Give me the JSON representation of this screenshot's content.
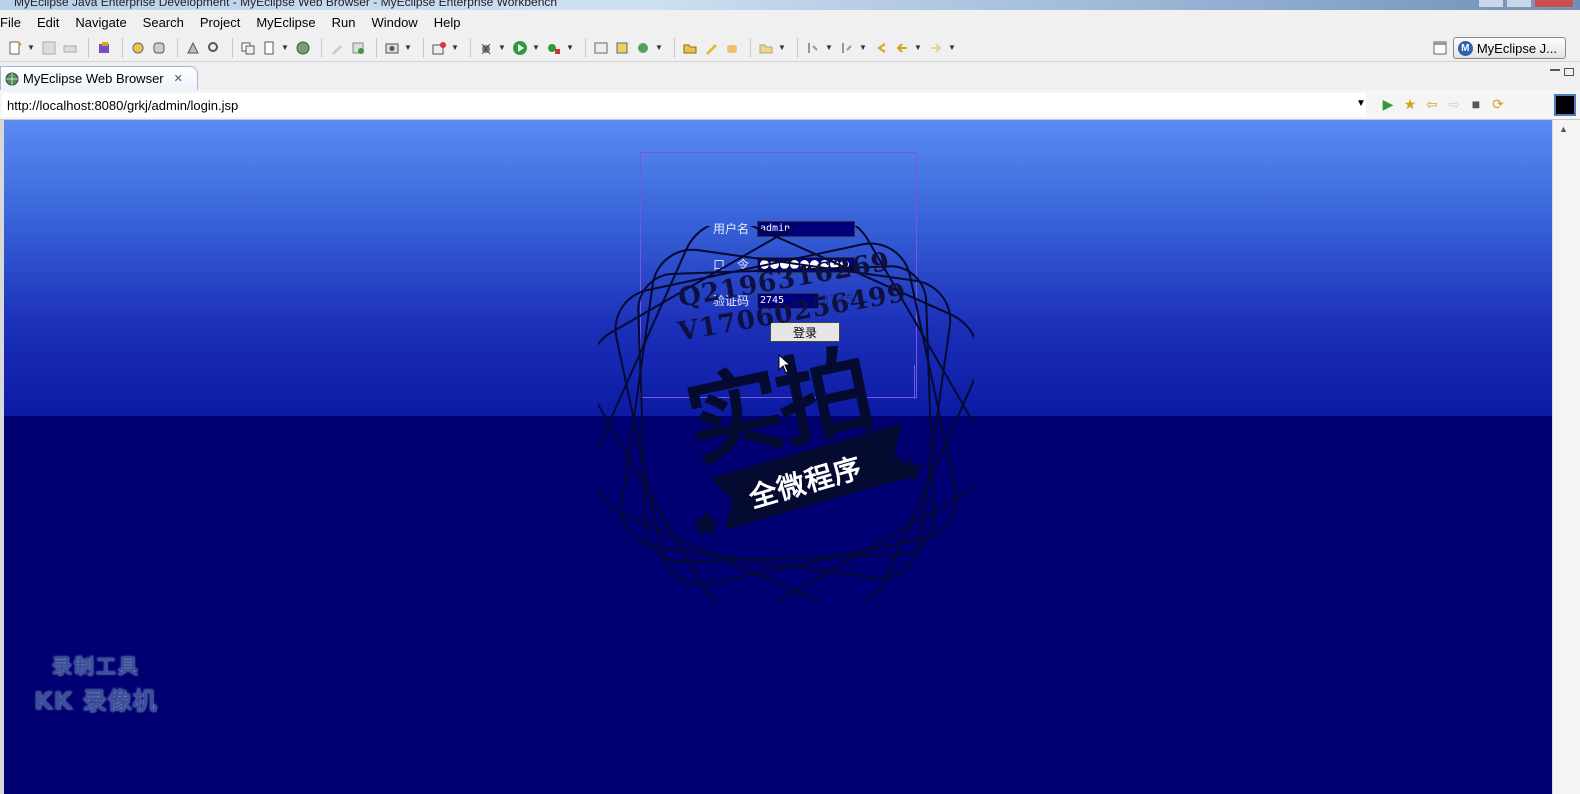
{
  "window": {
    "title": "MyEclipse Java Enterprise Development - MyEclipse Web Browser - MyEclipse Enterprise Workbench"
  },
  "menu": [
    "File",
    "Edit",
    "Navigate",
    "Search",
    "Project",
    "MyEclipse",
    "Run",
    "Window",
    "Help"
  ],
  "perspective": {
    "label": "MyEclipse J..."
  },
  "editor_tab": {
    "label": "MyEclipse Web Browser"
  },
  "address": {
    "url": "http://localhost:8080/grkj/admin/login.jsp"
  },
  "login": {
    "username_label": "用户名",
    "username_value": "admin",
    "password_label": "口　令",
    "captcha_label": "验证码",
    "captcha_input": "2745",
    "captcha_image": "2745",
    "submit_label": "登录"
  },
  "stamp": {
    "line1": "Q2196316269",
    "line2": "V17060256499",
    "big": "实拍",
    "banner": "全微程序"
  },
  "watermark": {
    "line1": "录制工具",
    "line2": "KK 录像机"
  },
  "colors": {
    "page_top": "#5a8cf2",
    "page_bottom": "#000073",
    "login_border": "#7a55e0"
  }
}
